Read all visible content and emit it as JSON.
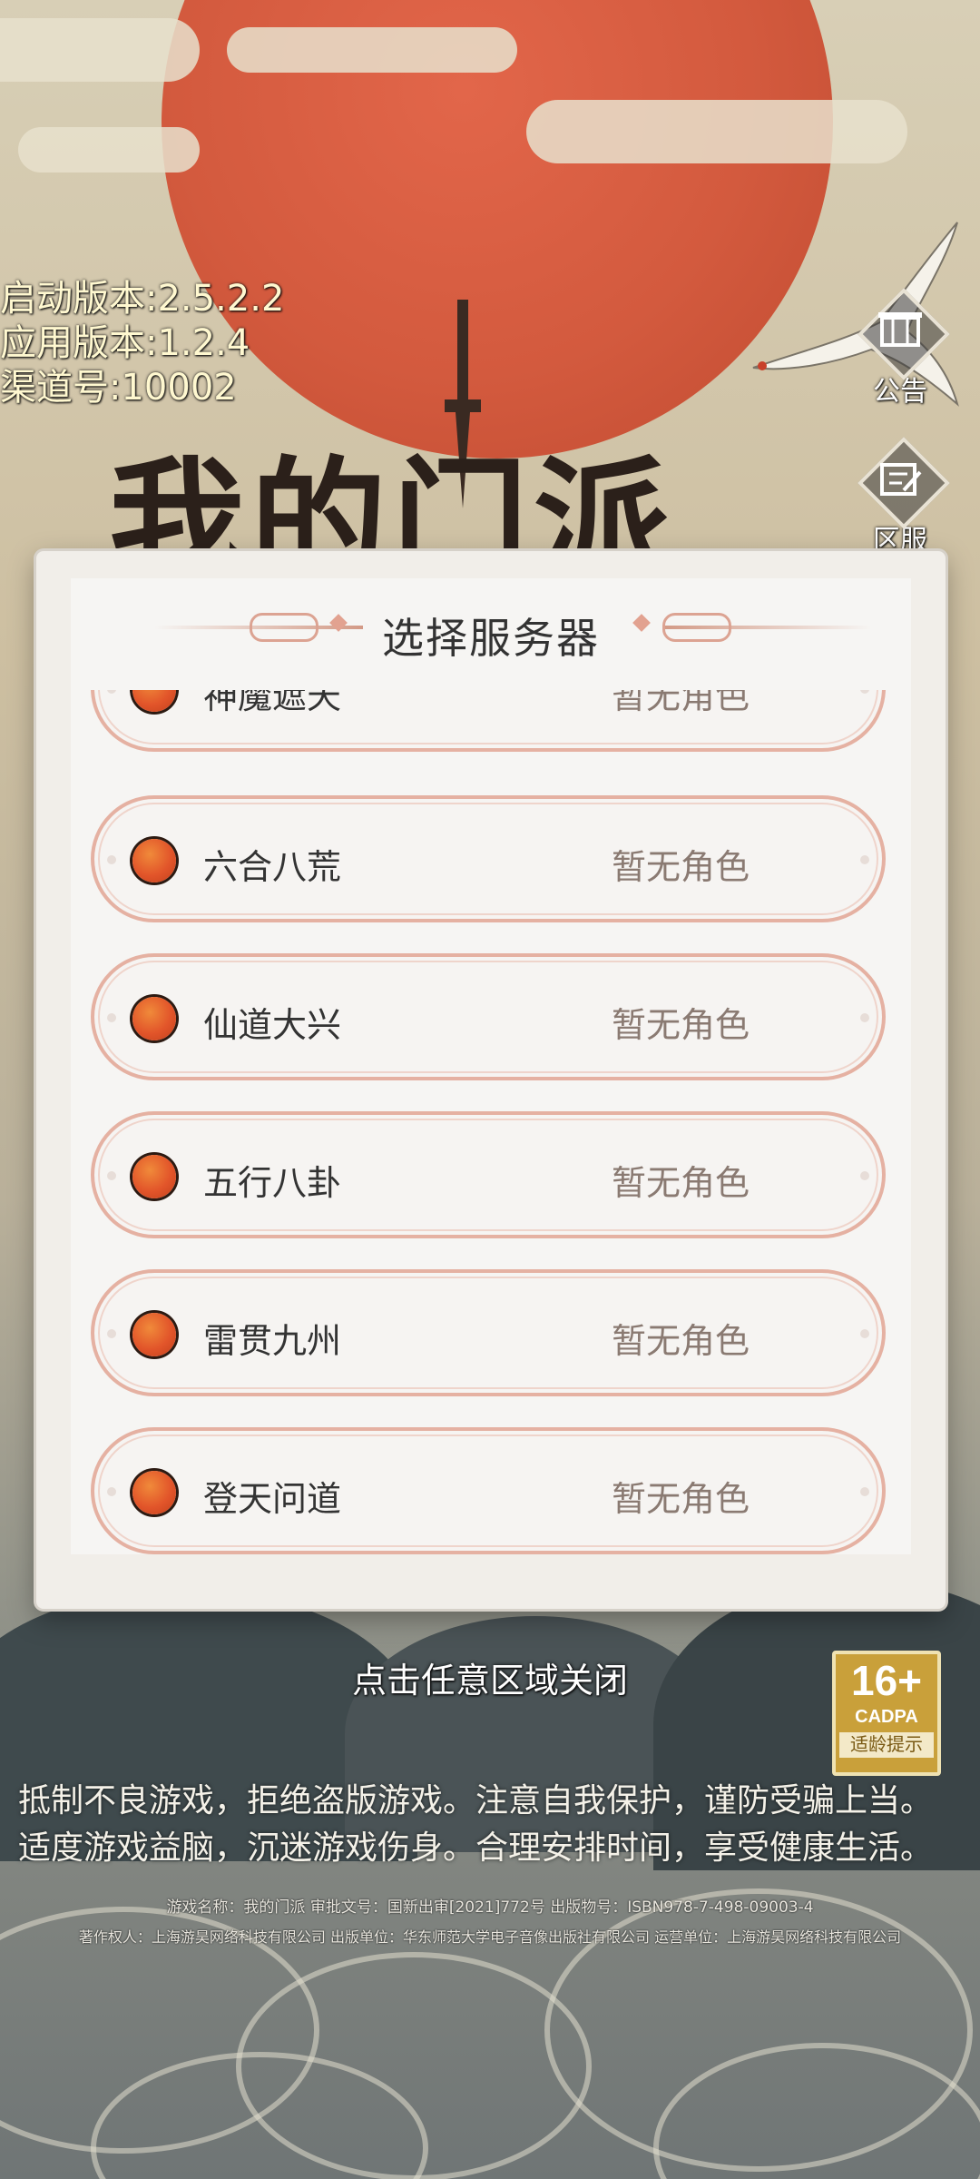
{
  "version_info": {
    "launcher": "启动版本:2.5.2.2",
    "app": "应用版本:1.2.4",
    "channel": "渠道号:10002"
  },
  "side_buttons": {
    "announcement": "公告",
    "server_zone": "区服"
  },
  "logo_text": "我的门派",
  "modal": {
    "title": "选择服务器",
    "servers": [
      {
        "name": "神魔遮天",
        "status": "暂无角色"
      },
      {
        "name": "六合八荒",
        "status": "暂无角色"
      },
      {
        "name": "仙道大兴",
        "status": "暂无角色"
      },
      {
        "name": "五行八卦",
        "status": "暂无角色"
      },
      {
        "name": "雷贯九州",
        "status": "暂无角色"
      },
      {
        "name": "登天问道",
        "status": "暂无角色"
      }
    ]
  },
  "close_hint": "点击任意区域关闭",
  "age_badge": {
    "age": "16+",
    "org": "CADPA",
    "label": "适龄提示"
  },
  "health_notice": {
    "line1": "抵制不良游戏，拒绝盗版游戏。注意自我保护，谨防受骗上当。",
    "line2": "适度游戏益脑，沉迷游戏伤身。合理安排时间，享受健康生活。"
  },
  "credits": {
    "line1": "游戏名称：我的门派 审批文号：国新出审[2021]772号 出版物号：ISBN978-7-498-09003-4",
    "line2": "著作权人：上海游昊网络科技有限公司 出版单位：华东师范大学电子音像出版社有限公司 运营单位：上海游昊网络科技有限公司"
  },
  "colors": {
    "sun": "#d35a3e",
    "row_border": "#e5b1a2",
    "server_dot": "#e2552a",
    "age_badge": "#c9a03a"
  }
}
